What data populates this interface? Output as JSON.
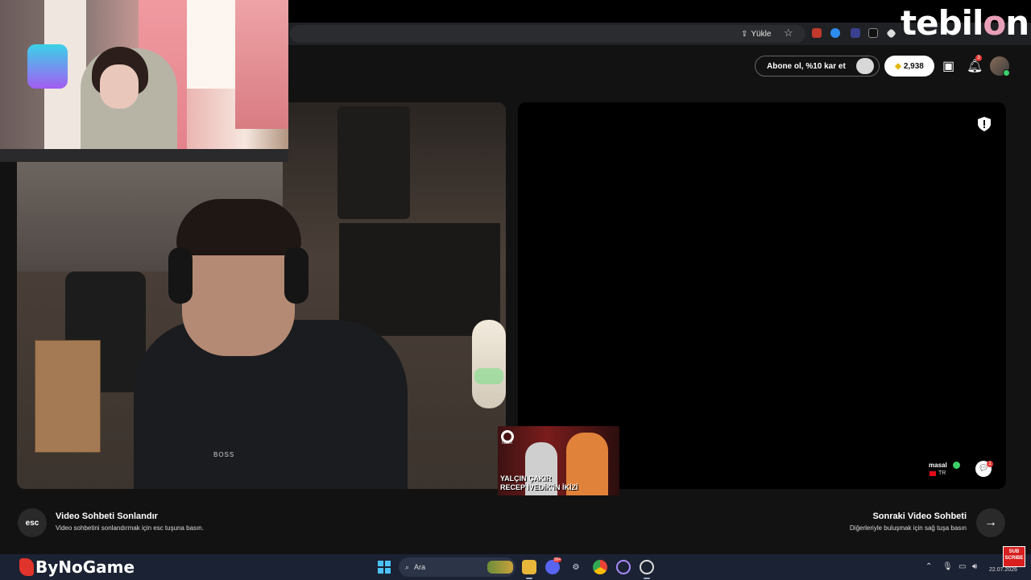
{
  "browser": {
    "upload_label": "Yükle",
    "brand": {
      "text_a": "tebil",
      "text_o": "o",
      "text_b": "n"
    }
  },
  "header": {
    "subscribe_label": "Abone ol, %10 kar et",
    "coins": "2,938",
    "notifications_count": "3"
  },
  "peer": {
    "name": "masal",
    "country": "TR"
  },
  "chat": {
    "badge": "1"
  },
  "controls": {
    "end": {
      "key": "esc",
      "title": "Video Sohbeti Sonlandır",
      "subtitle": "Video sohbetini sonlandırmak için esc tuşuna basın."
    },
    "next": {
      "title": "Sonraki Video Sohbeti",
      "subtitle": "Diğerleriyle buluşmak için sağ tuşa basın",
      "icon": "→"
    }
  },
  "webcam_shirt_logo": "BOSS",
  "clip": {
    "brand": "flash",
    "caption_line1": "YALÇIN ÇAKIR",
    "caption_line2": "RECEP İVEDİK'İN İKİZİ"
  },
  "taskbar": {
    "watermark": "ByNoGame",
    "search_placeholder": "Ara",
    "discord_badge": "99+",
    "date": "22.07.2026"
  },
  "subscribe_overlay": {
    "line1": "SUB",
    "line2": "SCRIBE"
  },
  "colors": {
    "background": "#121212",
    "panel": "#000000",
    "accent_green": "#3ccf6a",
    "badge_red": "#e53935",
    "taskbar": "#1b2233"
  }
}
